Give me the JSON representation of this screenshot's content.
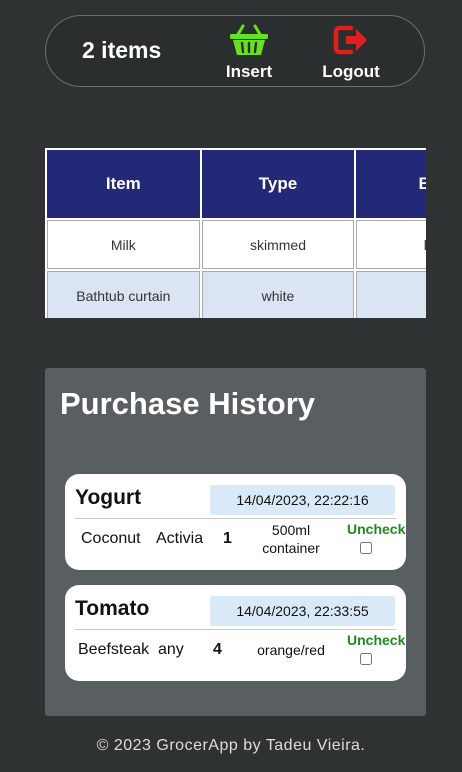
{
  "header": {
    "count_text": "2 items",
    "insert_label": "Insert",
    "logout_label": "Logout",
    "insert_icon": "basket-icon",
    "logout_icon": "logout-icon",
    "insert_color": "#66e01f",
    "logout_color": "#e02020"
  },
  "table": {
    "headers": [
      "Item",
      "Type",
      "Bra"
    ],
    "rows": [
      [
        "Milk",
        "skimmed",
        "luc"
      ],
      [
        "Bathtub curtain",
        "white",
        ""
      ]
    ]
  },
  "history": {
    "title": "Purchase History",
    "items": [
      {
        "name": "Yogurt",
        "date": "14/04/2023, 22:22:16",
        "type": "Coconut",
        "brand": "Activia",
        "qty": "1",
        "desc_l1": "500ml",
        "desc_l2": "container",
        "status": "Uncheck"
      },
      {
        "name": "Tomato",
        "date": "14/04/2023, 22:33:55",
        "type": "Beefsteak",
        "brand": "any",
        "qty": "4",
        "desc_l1": "orange/red",
        "desc_l2": "",
        "status": "Uncheck"
      }
    ]
  },
  "footer": {
    "text": "© 2023 GrocerApp by Tadeu Vieira."
  }
}
